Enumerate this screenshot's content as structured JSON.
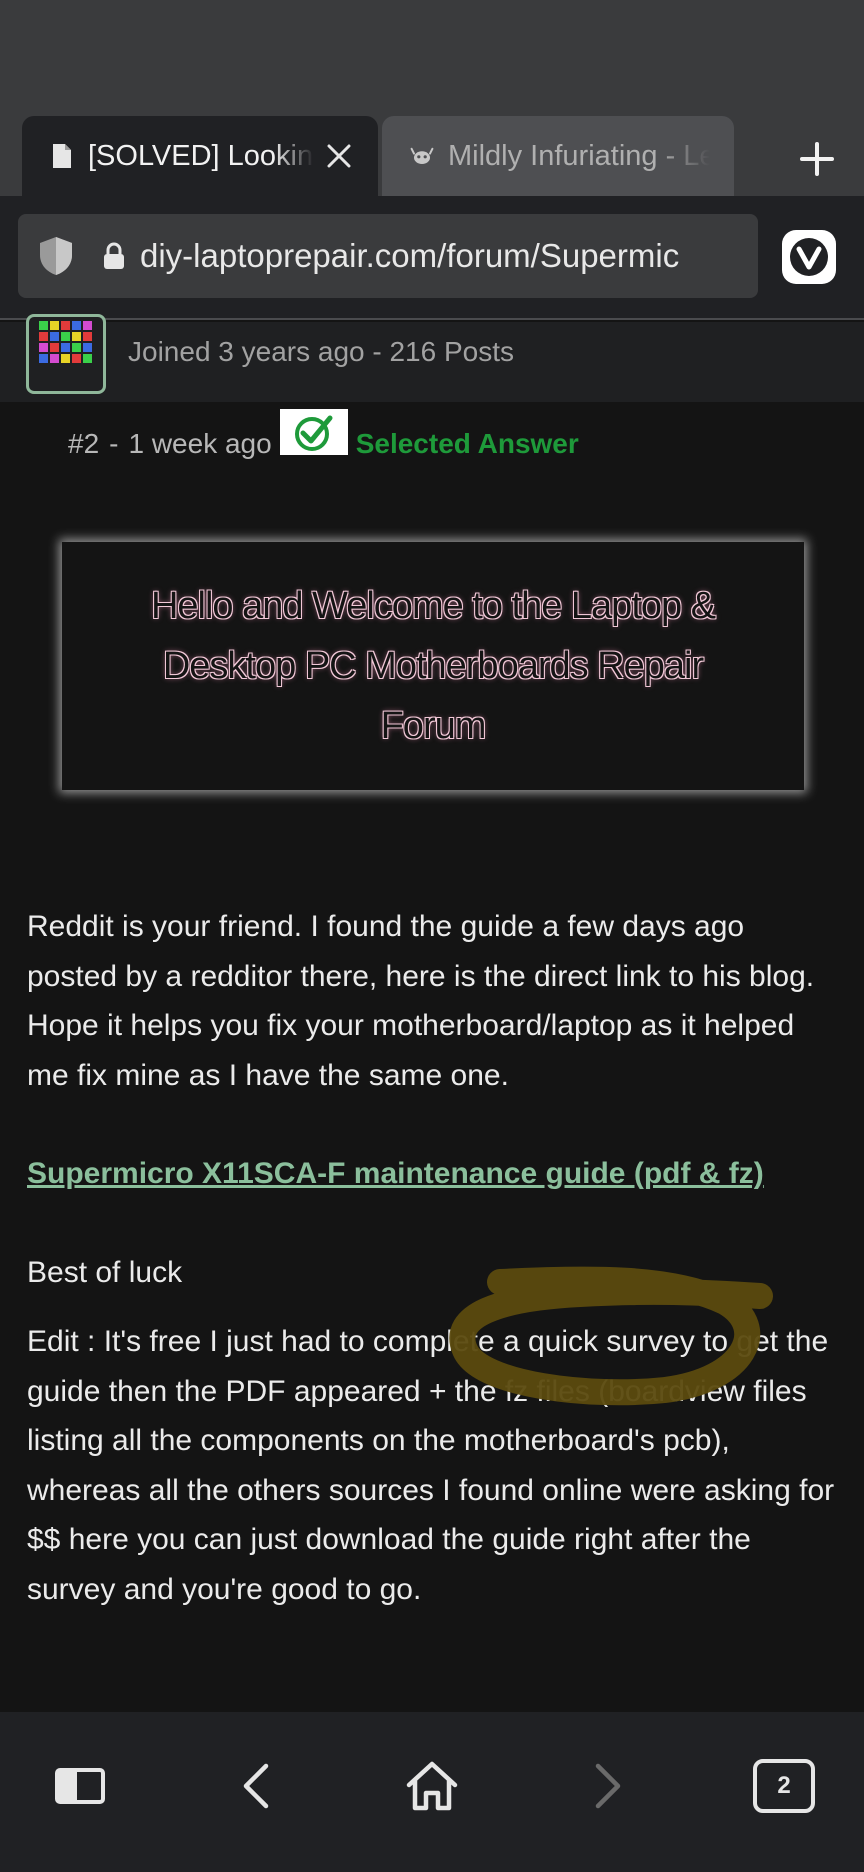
{
  "browser": {
    "tabs": [
      {
        "title": "[SOLVED] Looking fo",
        "icon": "document-icon",
        "active": true
      },
      {
        "title": "Mildly Infuriating - Le",
        "icon": "lemmy-icon",
        "active": false
      }
    ],
    "url": "diy-laptoprepair.com/forum/Supermic",
    "tab_count": "2"
  },
  "author": {
    "joined": "Joined 3 years ago - 216 Posts"
  },
  "post": {
    "number": "#2",
    "separator": "-",
    "time": "1 week ago",
    "selected_answer": "Selected Answer",
    "banner_text": "Hello and Welcome to the Laptop & Desktop PC Motherboards Repair Forum",
    "paragraph1": "Reddit is your friend. I found the guide a few days ago posted by a redditor there, here is the direct link to his blog. Hope it helps you fix your motherboard/laptop as it helped me fix mine as I have the same one.",
    "link_text": "Supermicro X11SCA-F maintenance guide (pdf & fz)",
    "sign_off": "Best of luck",
    "edit_text": "Edit : It's free I just had to complete a quick survey to get the guide then the PDF appeared + the fz files (boardview files listing all the components on the motherboard's pcb), whereas all the others sources I found online were asking for $$ here you can just download the guide right after the survey and you're good to go."
  },
  "colors": {
    "selected_green": "#1e9a3a",
    "link_green": "#8bbf9c",
    "doodle": "#5b4a0e"
  }
}
